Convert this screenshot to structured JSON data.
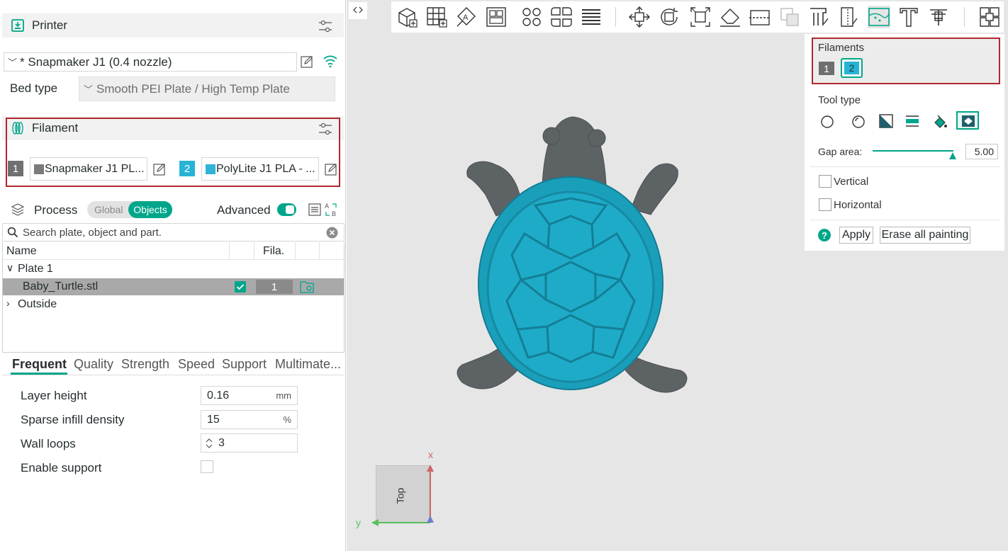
{
  "printer": {
    "title": "Printer",
    "name": "* Snapmaker J1 (0.4 nozzle)",
    "bed_type_label": "Bed type",
    "bed_type_value": "Smooth PEI Plate / High Temp Plate"
  },
  "filament": {
    "title": "Filament",
    "items": [
      {
        "index": "1",
        "name": "Snapmaker J1 PL...",
        "color": "#7b7b7b"
      },
      {
        "index": "2",
        "name": "PolyLite J1 PLA - ...",
        "color": "#2fb3d8"
      }
    ]
  },
  "process": {
    "title": "Process",
    "toggle_global": "Global",
    "toggle_objects": "Objects",
    "advanced_label": "Advanced"
  },
  "search": {
    "placeholder": "Search plate, object and part."
  },
  "object_list": {
    "col_name": "Name",
    "col_fila": "Fila.",
    "plate": "Plate 1",
    "object_name": "Baby_Turtle.stl",
    "object_fila": "1",
    "outside": "Outside"
  },
  "tabs": [
    "Frequent",
    "Quality",
    "Strength",
    "Speed",
    "Support",
    "Multimate..."
  ],
  "params": [
    {
      "label": "Layer height",
      "value": "0.16",
      "unit": "mm"
    },
    {
      "label": "Sparse infill density",
      "value": "15",
      "unit": "%"
    },
    {
      "label": "Wall loops",
      "value": "3",
      "unit": ""
    },
    {
      "label": "Enable support",
      "value": "",
      "unit": ""
    }
  ],
  "paint_panel": {
    "filaments_label": "Filaments",
    "filament_1": "1",
    "filament_2": "2",
    "tool_type_label": "Tool type",
    "gap_area_label": "Gap area:",
    "gap_area_value": "5.00",
    "vertical_label": "Vertical",
    "horizontal_label": "Horizontal",
    "apply_label": "Apply",
    "erase_label": "Erase all painting",
    "help": "?"
  },
  "view_cube": {
    "label": "Top",
    "x_axis": "x",
    "y_axis": "y"
  },
  "colors": {
    "accent": "#00a68a",
    "highlight": "#b0282f",
    "turtle_shell": "#1aa3bf",
    "turtle_body": "#5f6467"
  }
}
